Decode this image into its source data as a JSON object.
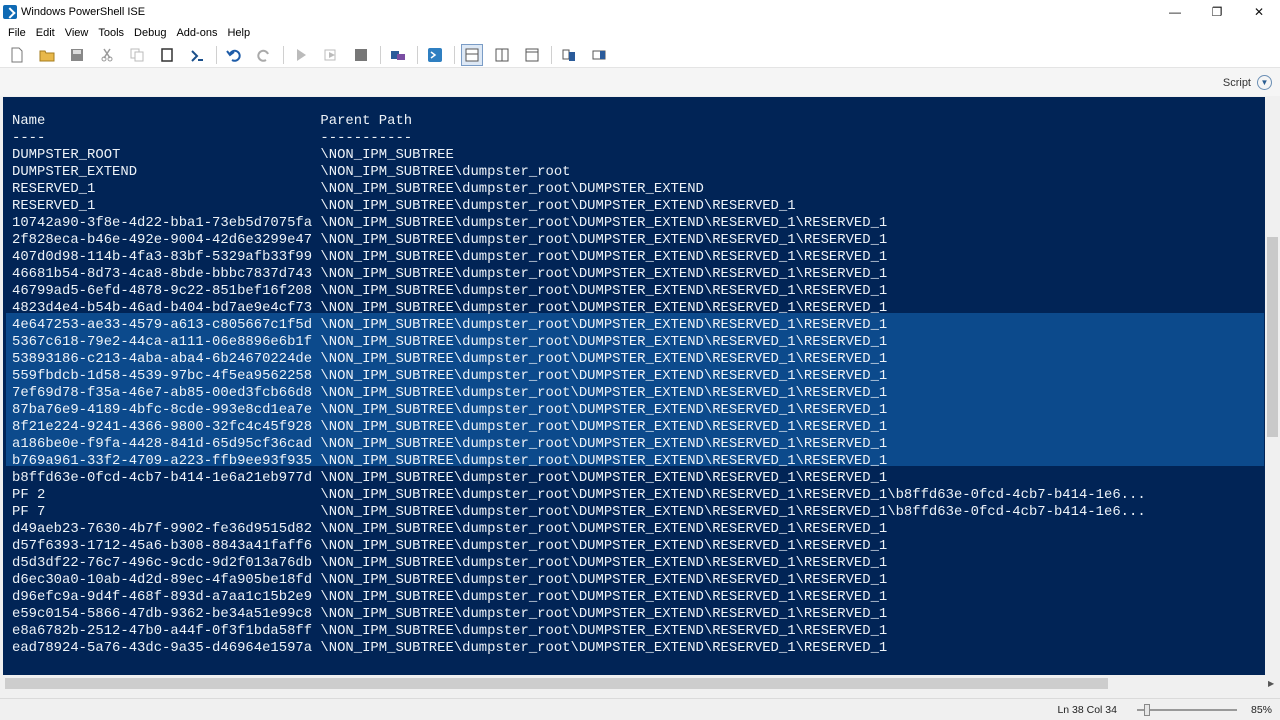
{
  "window": {
    "title": "Windows PowerShell ISE",
    "controls": {
      "minimize": "—",
      "restore": "❐",
      "close": "✕"
    }
  },
  "menu": [
    "File",
    "Edit",
    "View",
    "Tools",
    "Debug",
    "Add-ons",
    "Help"
  ],
  "toolbar": {
    "icons": [
      "new-file-icon",
      "open-folder-icon",
      "save-icon",
      "cut-icon",
      "copy-icon",
      "clear-console-icon",
      "run-command-icon",
      "undo-icon",
      "redo-icon",
      "run-script-icon",
      "run-selection-icon",
      "stop-icon",
      "remote-tab-icon",
      "powershell-icon",
      "layout-top-icon",
      "layout-right-icon",
      "layout-max-icon",
      "show-commands-icon",
      "command-addon-icon"
    ]
  },
  "script_toggle": {
    "label": "Script"
  },
  "console": {
    "header": {
      "name": "Name",
      "path": "Parent Path"
    },
    "underline": {
      "name": "----",
      "path": "-----------"
    },
    "rows": [
      {
        "name": "DUMPSTER_ROOT",
        "path": "\\NON_IPM_SUBTREE"
      },
      {
        "name": "DUMPSTER_EXTEND",
        "path": "\\NON_IPM_SUBTREE\\dumpster_root"
      },
      {
        "name": "RESERVED_1",
        "path": "\\NON_IPM_SUBTREE\\dumpster_root\\DUMPSTER_EXTEND"
      },
      {
        "name": "RESERVED_1",
        "path": "\\NON_IPM_SUBTREE\\dumpster_root\\DUMPSTER_EXTEND\\RESERVED_1"
      },
      {
        "name": "10742a90-3f8e-4d22-bba1-73eb5d7075fa",
        "path": "\\NON_IPM_SUBTREE\\dumpster_root\\DUMPSTER_EXTEND\\RESERVED_1\\RESERVED_1"
      },
      {
        "name": "2f828eca-b46e-492e-9004-42d6e3299e47",
        "path": "\\NON_IPM_SUBTREE\\dumpster_root\\DUMPSTER_EXTEND\\RESERVED_1\\RESERVED_1"
      },
      {
        "name": "407d0d98-114b-4fa3-83bf-5329afb33f99",
        "path": "\\NON_IPM_SUBTREE\\dumpster_root\\DUMPSTER_EXTEND\\RESERVED_1\\RESERVED_1"
      },
      {
        "name": "46681b54-8d73-4ca8-8bde-bbbc7837d743",
        "path": "\\NON_IPM_SUBTREE\\dumpster_root\\DUMPSTER_EXTEND\\RESERVED_1\\RESERVED_1"
      },
      {
        "name": "46799ad5-6efd-4878-9c22-851bef16f208",
        "path": "\\NON_IPM_SUBTREE\\dumpster_root\\DUMPSTER_EXTEND\\RESERVED_1\\RESERVED_1"
      },
      {
        "name": "4823d4e4-b54b-46ad-b404-bd7ae9e4cf73",
        "path": "\\NON_IPM_SUBTREE\\dumpster_root\\DUMPSTER_EXTEND\\RESERVED_1\\RESERVED_1"
      },
      {
        "name": "4e647253-ae33-4579-a613-c805667c1f5d",
        "path": "\\NON_IPM_SUBTREE\\dumpster_root\\DUMPSTER_EXTEND\\RESERVED_1\\RESERVED_1"
      },
      {
        "name": "5367c618-79e2-44ca-a111-06e8896e6b1f",
        "path": "\\NON_IPM_SUBTREE\\dumpster_root\\DUMPSTER_EXTEND\\RESERVED_1\\RESERVED_1"
      },
      {
        "name": "53893186-c213-4aba-aba4-6b24670224de",
        "path": "\\NON_IPM_SUBTREE\\dumpster_root\\DUMPSTER_EXTEND\\RESERVED_1\\RESERVED_1"
      },
      {
        "name": "559fbdcb-1d58-4539-97bc-4f5ea9562258",
        "path": "\\NON_IPM_SUBTREE\\dumpster_root\\DUMPSTER_EXTEND\\RESERVED_1\\RESERVED_1"
      },
      {
        "name": "7ef69d78-f35a-46e7-ab85-00ed3fcb66d8",
        "path": "\\NON_IPM_SUBTREE\\dumpster_root\\DUMPSTER_EXTEND\\RESERVED_1\\RESERVED_1"
      },
      {
        "name": "87ba76e9-4189-4bfc-8cde-993e8cd1ea7e",
        "path": "\\NON_IPM_SUBTREE\\dumpster_root\\DUMPSTER_EXTEND\\RESERVED_1\\RESERVED_1"
      },
      {
        "name": "8f21e224-9241-4366-9800-32fc4c45f928",
        "path": "\\NON_IPM_SUBTREE\\dumpster_root\\DUMPSTER_EXTEND\\RESERVED_1\\RESERVED_1"
      },
      {
        "name": "a186be0e-f9fa-4428-841d-65d95cf36cad",
        "path": "\\NON_IPM_SUBTREE\\dumpster_root\\DUMPSTER_EXTEND\\RESERVED_1\\RESERVED_1"
      },
      {
        "name": "b769a961-33f2-4709-a223-ffb9ee93f935",
        "path": "\\NON_IPM_SUBTREE\\dumpster_root\\DUMPSTER_EXTEND\\RESERVED_1\\RESERVED_1"
      },
      {
        "name": "b8ffd63e-0fcd-4cb7-b414-1e6a21eb977d",
        "path": "\\NON_IPM_SUBTREE\\dumpster_root\\DUMPSTER_EXTEND\\RESERVED_1\\RESERVED_1"
      },
      {
        "name": "PF 2",
        "path": "\\NON_IPM_SUBTREE\\dumpster_root\\DUMPSTER_EXTEND\\RESERVED_1\\RESERVED_1\\b8ffd63e-0fcd-4cb7-b414-1e6..."
      },
      {
        "name": "PF 7",
        "path": "\\NON_IPM_SUBTREE\\dumpster_root\\DUMPSTER_EXTEND\\RESERVED_1\\RESERVED_1\\b8ffd63e-0fcd-4cb7-b414-1e6..."
      },
      {
        "name": "d49aeb23-7630-4b7f-9902-fe36d9515d82",
        "path": "\\NON_IPM_SUBTREE\\dumpster_root\\DUMPSTER_EXTEND\\RESERVED_1\\RESERVED_1"
      },
      {
        "name": "d57f6393-1712-45a6-b308-8843a41faff6",
        "path": "\\NON_IPM_SUBTREE\\dumpster_root\\DUMPSTER_EXTEND\\RESERVED_1\\RESERVED_1"
      },
      {
        "name": "d5d3df22-76c7-496c-9cdc-9d2f013a76db",
        "path": "\\NON_IPM_SUBTREE\\dumpster_root\\DUMPSTER_EXTEND\\RESERVED_1\\RESERVED_1"
      },
      {
        "name": "d6ec30a0-10ab-4d2d-89ec-4fa905be18fd",
        "path": "\\NON_IPM_SUBTREE\\dumpster_root\\DUMPSTER_EXTEND\\RESERVED_1\\RESERVED_1"
      },
      {
        "name": "d96efc9a-9d4f-468f-893d-a7aa1c15b2e9",
        "path": "\\NON_IPM_SUBTREE\\dumpster_root\\DUMPSTER_EXTEND\\RESERVED_1\\RESERVED_1"
      },
      {
        "name": "e59c0154-5866-47db-9362-be34a51e99c8",
        "path": "\\NON_IPM_SUBTREE\\dumpster_root\\DUMPSTER_EXTEND\\RESERVED_1\\RESERVED_1"
      },
      {
        "name": "e8a6782b-2512-47b0-a44f-0f3f1bda58ff",
        "path": "\\NON_IPM_SUBTREE\\dumpster_root\\DUMPSTER_EXTEND\\RESERVED_1\\RESERVED_1"
      },
      {
        "name": "ead78924-5a76-43dc-9a35-d46964e1597a",
        "path": "\\NON_IPM_SUBTREE\\dumpster_root\\DUMPSTER_EXTEND\\RESERVED_1\\RESERVED_1"
      }
    ]
  },
  "status": {
    "line_col": "Ln 38  Col 34",
    "zoom": "85%"
  },
  "colors": {
    "console_bg": "#012456",
    "console_fg": "#eef3f8",
    "selection": "#0c4a8c"
  }
}
